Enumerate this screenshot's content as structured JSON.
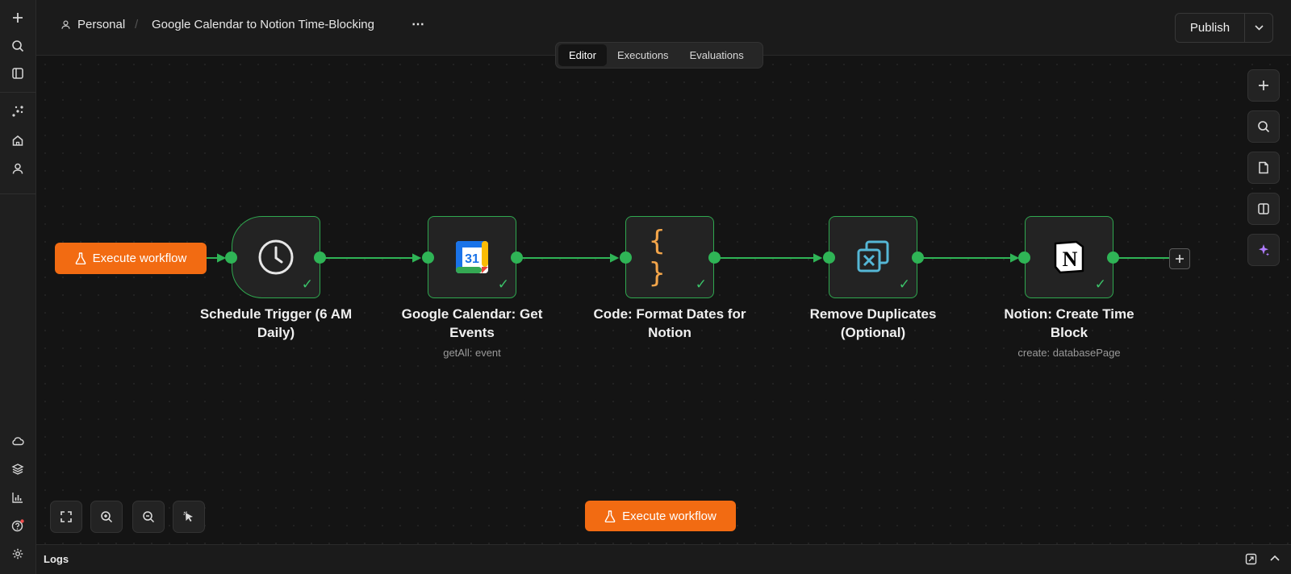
{
  "breadcrumb": {
    "project": "Personal",
    "separator": "/",
    "workflow_name": "Google Calendar to Notion Time-Blocking",
    "more": "⋯"
  },
  "tabs": [
    {
      "label": "Editor",
      "active": true
    },
    {
      "label": "Executions"
    },
    {
      "label": "Evaluations"
    }
  ],
  "publish": {
    "label": "Publish"
  },
  "execute_workflow_label": "Execute workflow",
  "nodes": [
    {
      "label": "Schedule Trigger (6 AM Daily)",
      "subtitle": "",
      "icon": "clock-icon"
    },
    {
      "label": "Google Calendar: Get Events",
      "subtitle": "getAll: event",
      "icon": "google-calendar-icon",
      "icon_text": "31"
    },
    {
      "label": "Code: Format Dates for Notion",
      "subtitle": "",
      "icon": "code-braces-icon",
      "icon_text": "{ }"
    },
    {
      "label": "Remove Duplicates (Optional)",
      "subtitle": "",
      "icon": "remove-duplicates-icon"
    },
    {
      "label": "Notion: Create Time Block",
      "subtitle": "create: databasePage",
      "icon": "notion-icon",
      "icon_text": "N"
    }
  ],
  "logs": {
    "label": "Logs"
  },
  "colors": {
    "accent": "#f26b12",
    "success": "#2fb456",
    "node_border": "#2fa84f"
  }
}
